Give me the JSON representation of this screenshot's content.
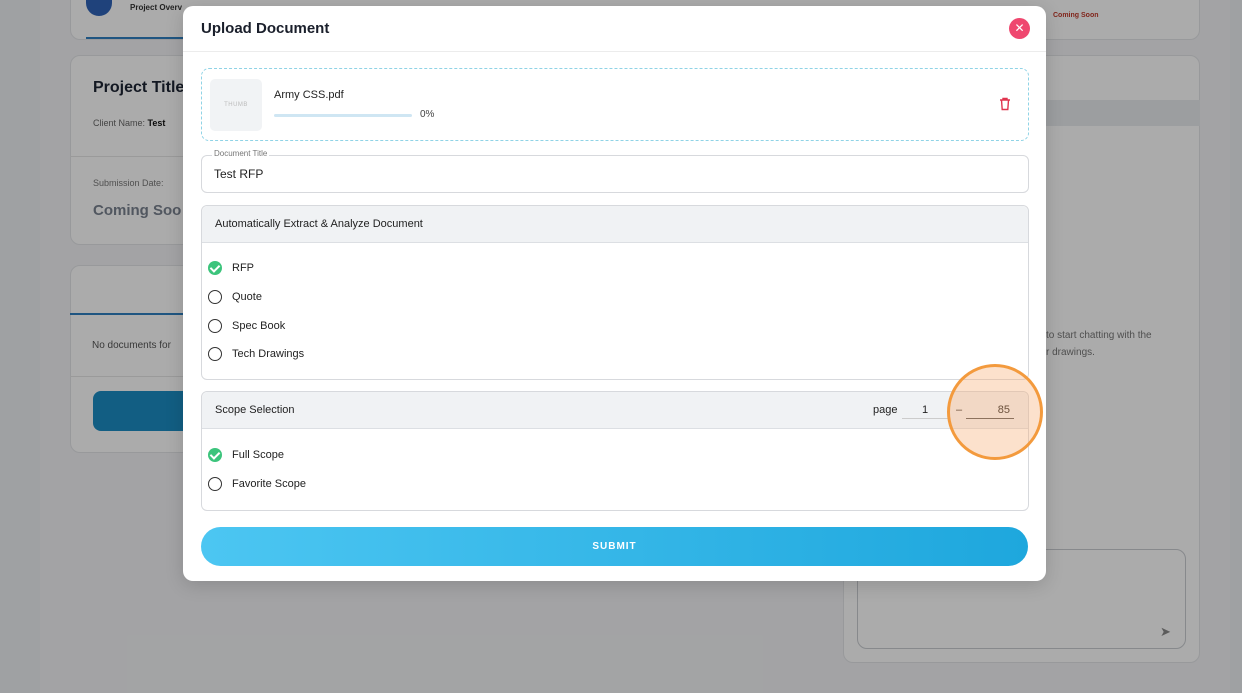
{
  "background": {
    "tab_label": "Project Overv",
    "coming_soon_top": "Coming Soon",
    "project_title": "Project Title",
    "client_label": "Client Name:",
    "client_value": "Test",
    "submission_label": "Submission Date:",
    "submission_value": "Coming Soo",
    "no_documents": "No documents for",
    "chat_hint_line1": "to start chatting with the",
    "chat_hint_line2": "r drawings."
  },
  "modal": {
    "title": "Upload Document",
    "close_icon": "close-icon",
    "file": {
      "thumb_label": "THUMB",
      "name": "Army CSS.pdf",
      "progress_percent": 0,
      "progress_text": "0%",
      "delete_icon": "trash-icon"
    },
    "document_title_label": "Document Title",
    "document_title_value": "Test RFP",
    "extract_section": {
      "title": "Automatically Extract & Analyze Document",
      "options": [
        {
          "label": "RFP",
          "selected": true
        },
        {
          "label": "Quote",
          "selected": false
        },
        {
          "label": "Spec Book",
          "selected": false
        },
        {
          "label": "Tech Drawings",
          "selected": false
        }
      ]
    },
    "scope_section": {
      "title": "Scope Selection",
      "page_label": "page",
      "page_from": "1",
      "page_dash": "–",
      "page_to": "85",
      "options": [
        {
          "label": "Full Scope",
          "selected": true
        },
        {
          "label": "Favorite Scope",
          "selected": false
        }
      ]
    },
    "submit_label": "SUBMIT"
  },
  "colors": {
    "accent": "#1ea7dd",
    "close": "#ef476f",
    "check": "#3cc47c",
    "highlight": "#f39a3d"
  }
}
